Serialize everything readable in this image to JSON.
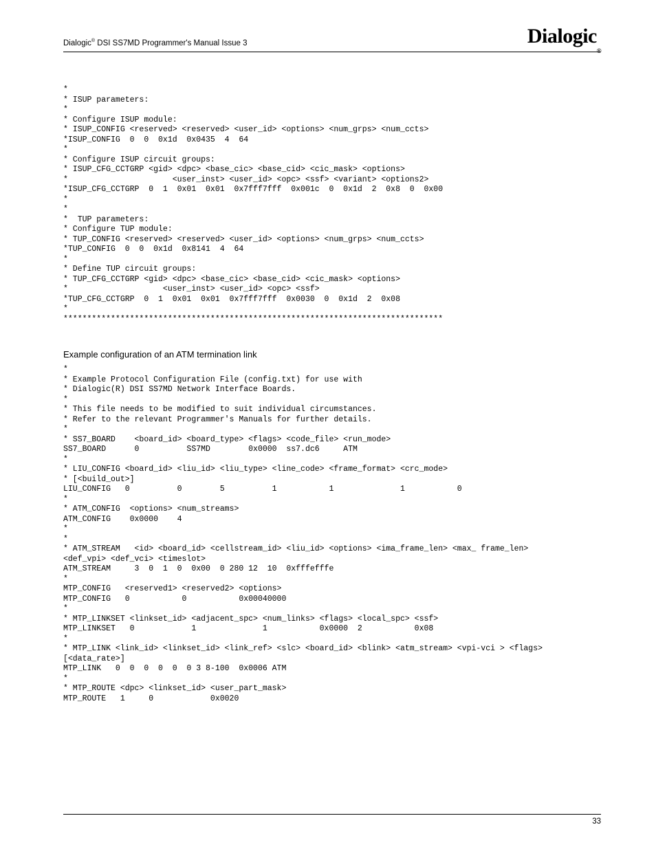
{
  "header": {
    "product_prefix": "Dialogic",
    "product_suffix": " DSI SS7MD Programmer's Manual Issue 3",
    "logo_text": "Dialogic"
  },
  "code1": "*\n* ISUP parameters:\n*\n* Configure ISUP module:\n* ISUP_CONFIG <reserved> <reserved> <user_id> <options> <num_grps> <num_ccts>\n*ISUP_CONFIG  0  0  0x1d  0x0435  4  64\n*\n* Configure ISUP circuit groups:\n* ISUP_CFG_CCTGRP <gid> <dpc> <base_cic> <base_cid> <cic_mask> <options>\n*                      <user_inst> <user_id> <opc> <ssf> <variant> <options2>\n*ISUP_CFG_CCTGRP  0  1  0x01  0x01  0x7fff7fff  0x001c  0  0x1d  2  0x8  0  0x00\n*\n*\n*  TUP parameters:\n* Configure TUP module:\n* TUP_CONFIG <reserved> <reserved> <user_id> <options> <num_grps> <num_ccts>\n*TUP_CONFIG  0  0  0x1d  0x8141  4  64\n*\n* Define TUP circuit groups:\n* TUP_CFG_CCTGRP <gid> <dpc> <base_cic> <base_cid> <cic_mask> <options>\n*                    <user_inst> <user_id> <opc> <ssf>\n*TUP_CFG_CCTGRP  0  1  0x01  0x01  0x7fff7fff  0x0030  0  0x1d  2  0x08\n*\n********************************************************************************",
  "section_heading": "Example configuration of an ATM termination link",
  "code2": "*\n* Example Protocol Configuration File (config.txt) for use with\n* Dialogic(R) DSI SS7MD Network Interface Boards.\n*\n* This file needs to be modified to suit individual circumstances.\n* Refer to the relevant Programmer's Manuals for further details.\n*\n* SS7_BOARD    <board_id> <board_type> <flags> <code_file> <run_mode>\nSS7_BOARD      0          SS7MD        0x0000  ss7.dc6     ATM\n*\n* LIU_CONFIG <board_id> <liu_id> <liu_type> <line_code> <frame_format> <crc_mode>\n* [<build_out>]\nLIU_CONFIG   0          0        5          1           1              1           0\n*\n* ATM_CONFIG  <options> <num_streams>\nATM_CONFIG    0x0000    4\n*\n*\n* ATM_STREAM   <id> <board_id> <cellstream_id> <liu_id> <options> <ima_frame_len> <max_ frame_len>\n<def_vpi> <def_vci> <timeslot>\nATM_STREAM     3  0  1  0  0x00  0 280 12  10  0xfffefffe\n*\nMTP_CONFIG   <reserved1> <reserved2> <options>\nMTP_CONFIG   0           0           0x00040000\n*\n* MTP_LINKSET <linkset_id> <adjacent_spc> <num_links> <flags> <local_spc> <ssf>\nMTP_LINKSET   0            1              1           0x0000  2           0x08\n*\n* MTP_LINK <link_id> <linkset_id> <link_ref> <slc> <board_id> <blink> <atm_stream> <vpi-vci > <flags>\n[<data_rate>]\nMTP_LINK   0  0  0  0  0  0 3 8-100  0x0006 ATM\n*\n* MTP_ROUTE <dpc> <linkset_id> <user_part_mask>\nMTP_ROUTE   1     0            0x0020",
  "footer": {
    "page_number": "33"
  }
}
